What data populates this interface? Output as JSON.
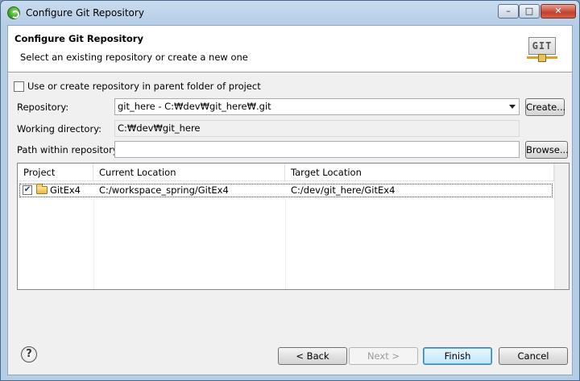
{
  "window": {
    "title": "Configure Git Repository",
    "minimize": "–",
    "maximize": "□",
    "close": "✕"
  },
  "banner": {
    "title": "Configure Git Repository",
    "message": "Select an existing repository or create a new one",
    "logo_text": "GIT"
  },
  "form": {
    "parent_checkbox_label": "Use or create repository in parent folder of project",
    "parent_checked": false,
    "repository_label": "Repository:",
    "repository_value": "git_here - C:₩dev₩git_here₩.git",
    "create_button": "Create...",
    "working_dir_label": "Working directory:",
    "working_dir_value": "C:₩dev₩git_here",
    "path_label": "Path within repository:",
    "path_value": "",
    "browse_button": "Browse..."
  },
  "table": {
    "columns": [
      "Project",
      "Current Location",
      "Target Location"
    ],
    "rows": [
      {
        "checked": true,
        "project": "GitEx4",
        "current": "C:/workspace_spring/GitEx4",
        "target": "C:/dev/git_here/GitEx4"
      }
    ]
  },
  "footer": {
    "help": "?",
    "back": "< Back",
    "next": "Next >",
    "finish": "Finish",
    "cancel": "Cancel"
  },
  "colors": {
    "title_gradient": "#c9dcf0",
    "default_button_border": "#3c7fb1"
  }
}
